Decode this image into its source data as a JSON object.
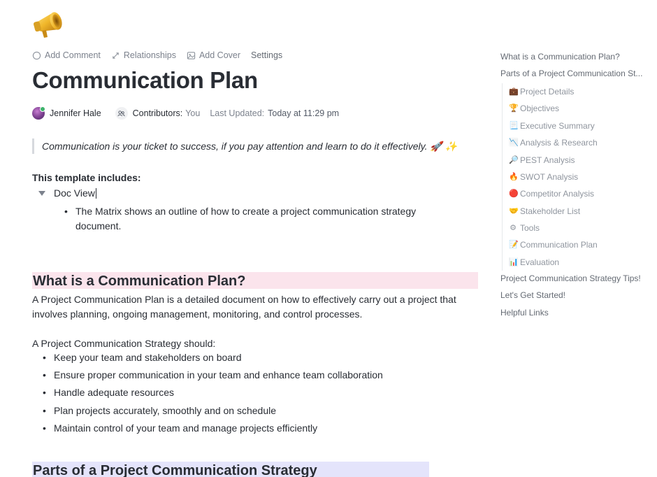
{
  "document": {
    "cover_emoji": "megaphone-icon",
    "toolbar": {
      "add_comment": "Add Comment",
      "relationships": "Relationships",
      "add_cover": "Add Cover",
      "settings": "Settings"
    },
    "title": "Communication Plan",
    "meta": {
      "author": "Jennifer Hale",
      "contributors_label": "Contributors:",
      "contributors_value": "You",
      "updated_label": "Last Updated:",
      "updated_value": "Today at 11:29 pm"
    },
    "quote": "Communication is your ticket to success, if you pay attention and learn to do it effectively. 🚀 ✨",
    "includes_heading": "This template includes:",
    "toggle_label": "Doc View",
    "toggle_bullet": "The Matrix shows an outline of how to create a project communication strategy document.",
    "section1": {
      "heading": "What is a Communication Plan?",
      "paragraph": "A Project Communication Plan is a detailed document on how to effectively carry out a project that involves planning, ongoing management, monitoring, and control processes.",
      "list_intro": "A Project Communication Strategy should:",
      "bullets": [
        "Keep your team and stakeholders on board",
        "Ensure proper communication in your team and enhance team collaboration",
        "Handle adequate resources",
        "Plan projects accurately, smoothly and on schedule",
        "Maintain control of your team and manage projects efficiently"
      ]
    },
    "section2": {
      "heading": "Parts of a Project Communication Strategy"
    }
  },
  "toc": {
    "top1": "What is a Communication Plan?",
    "top2": "Parts of a Project Communication St...",
    "sub": [
      {
        "emoji": "💼",
        "label": "Project Details"
      },
      {
        "emoji": "🏆",
        "label": "Objectives"
      },
      {
        "emoji": "📃",
        "label": "Executive Summary"
      },
      {
        "emoji": "📉",
        "label": "Analysis & Research"
      },
      {
        "emoji": "🔎",
        "label": "PEST Analysis"
      },
      {
        "emoji": "🔥",
        "label": "SWOT Analysis"
      },
      {
        "emoji": "🔴",
        "label": "Competitor Analysis"
      },
      {
        "emoji": "🤝",
        "label": "Stakeholder List"
      },
      {
        "emoji": "⚙",
        "label": "Tools"
      },
      {
        "emoji": "📝",
        "label": "Communication Plan"
      },
      {
        "emoji": "📊",
        "label": "Evaluation"
      }
    ],
    "bottom": [
      "Project Communication Strategy Tips!",
      "Let's Get Started!",
      "Helpful Links"
    ]
  },
  "colors": {
    "heading_pink": "#fbe4ec",
    "heading_lavender": "#e4e4fb",
    "text": "#292d34",
    "muted": "#7c828d"
  }
}
